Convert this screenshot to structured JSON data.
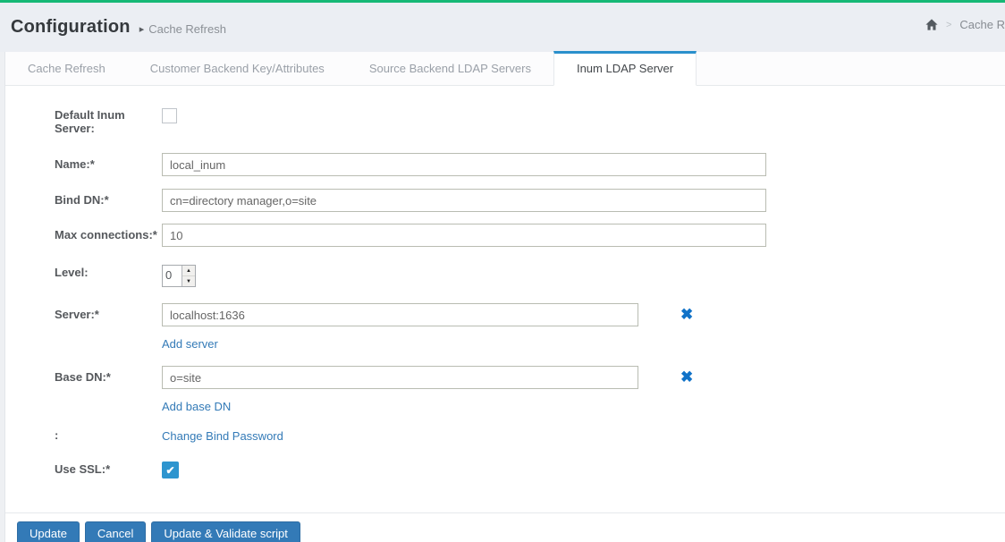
{
  "header": {
    "title": "Configuration",
    "section": "Cache Refresh",
    "breadcrumb": {
      "separator": ">",
      "label": "Cache R"
    }
  },
  "tabs": [
    {
      "label": "Cache Refresh",
      "active": false
    },
    {
      "label": "Customer Backend Key/Attributes",
      "active": false
    },
    {
      "label": "Source Backend LDAP Servers",
      "active": false
    },
    {
      "label": "Inum LDAP Server",
      "active": true
    }
  ],
  "form": {
    "default_inum_server": {
      "label": "Default Inum Server:",
      "checked": false
    },
    "name": {
      "label": "Name:*",
      "value": "local_inum"
    },
    "bind_dn": {
      "label": "Bind DN:*",
      "value": "cn=directory manager,o=site"
    },
    "max_connections": {
      "label": "Max connections:*",
      "value": "10"
    },
    "level": {
      "label": "Level:",
      "value": "0"
    },
    "server": {
      "label": "Server:*",
      "value": "localhost:1636",
      "add_link": "Add server"
    },
    "base_dn": {
      "label": "Base DN:*",
      "value": "o=site",
      "add_link": "Add base DN"
    },
    "bind_password": {
      "label": ":",
      "link": "Change Bind Password"
    },
    "use_ssl": {
      "label": "Use SSL:*",
      "checked": true
    }
  },
  "buttons": {
    "update": "Update",
    "cancel": "Cancel",
    "update_validate": "Update & Validate script"
  },
  "icons": {
    "remove": "✖",
    "check": "✔",
    "spinner_up": "▲",
    "spinner_down": "▼",
    "caret_right": "▸"
  },
  "colors": {
    "top_bar_green": "#16b876",
    "header_background": "#ebeef3",
    "active_tab_accent": "#2a90cc",
    "link_blue": "#337ab7",
    "button_blue": "#337ab7",
    "remove_icon_blue": "#1072c8",
    "checkbox_checked_blue": "#2e95cf"
  }
}
